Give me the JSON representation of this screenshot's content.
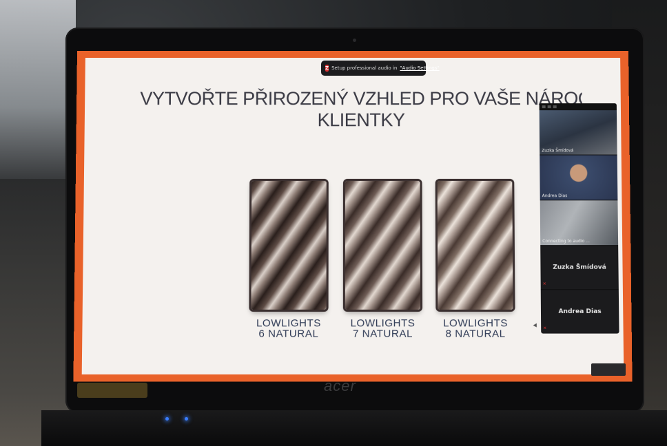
{
  "notification": {
    "icon": "zoom-icon",
    "text": "Setup professional audio in",
    "link": "\"Audio Settings\""
  },
  "slide": {
    "title_line1": "VYTVOŘTE PŘIROZENÝ VZHLED PRO VAŠE NÁROČNÉ BLO",
    "title_line2": "KLIENTKY",
    "swatches": [
      {
        "line1": "LOWLIGHTS",
        "line2": "6 NATURAL",
        "tone": "#6b5a52"
      },
      {
        "line1": "LOWLIGHTS",
        "line2": "7 NATURAL",
        "tone": "#7b6a60"
      },
      {
        "line1": "LOWLIGHTS",
        "line2": "8 NATURAL",
        "tone": "#8a7a70"
      }
    ]
  },
  "participants": {
    "tiles": [
      {
        "name": "Zuzka Šmídová"
      },
      {
        "name": "Andrea Dias"
      },
      {
        "name": "Connecting to audio ..."
      }
    ],
    "name_tiles": [
      {
        "name": "Zuzka Šmídová"
      },
      {
        "name": "Andrea Dias"
      }
    ]
  },
  "brand": {
    "logo": "acer"
  },
  "colors": {
    "screen_border": "#e9622a",
    "slide_bg": "#f4f1ee",
    "title_text": "#3b3b45",
    "label_text": "#2e3a55",
    "panel_bg": "#1b1b1d",
    "led": "#3a7dff"
  }
}
